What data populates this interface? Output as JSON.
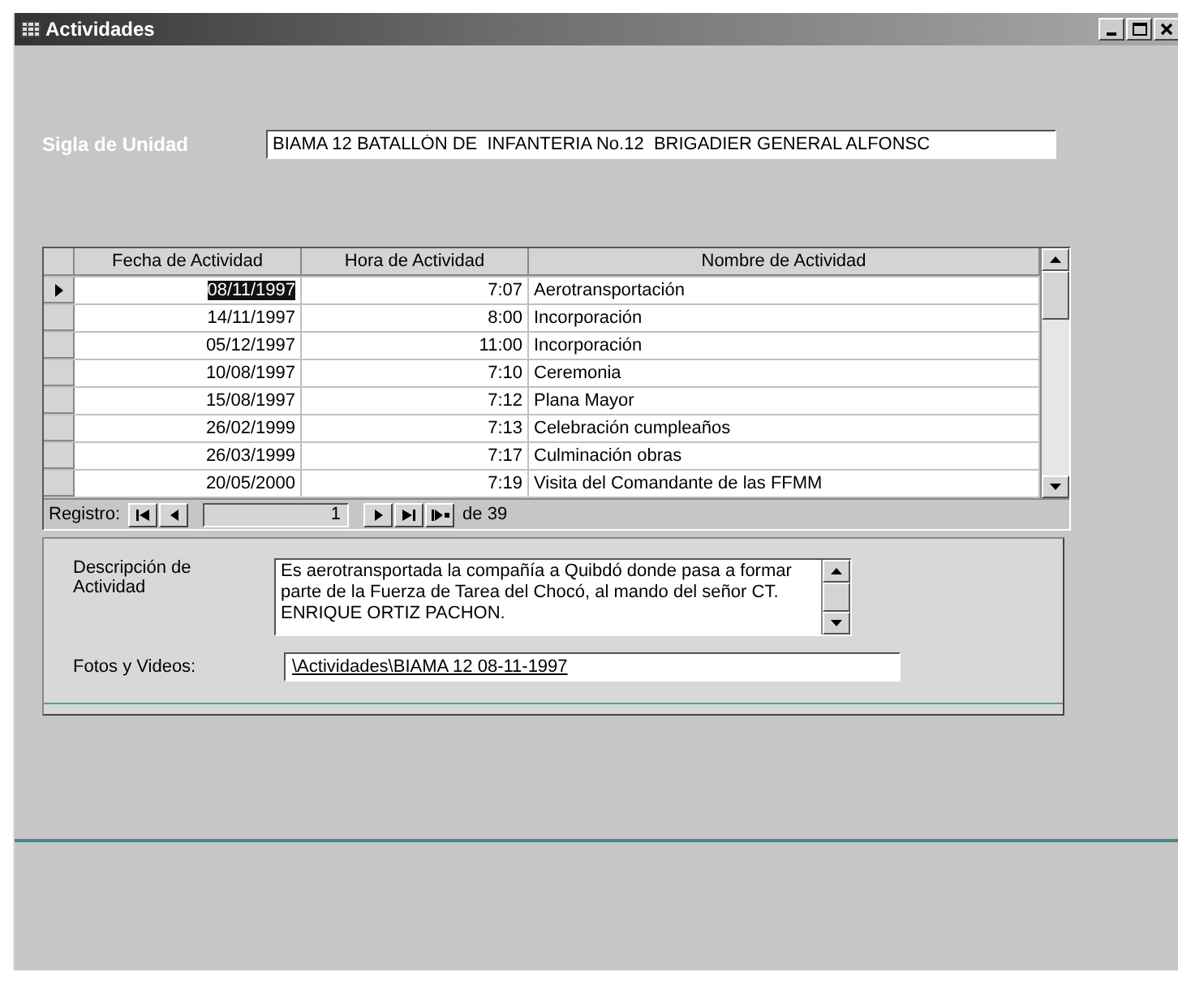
{
  "window": {
    "title": "Actividades"
  },
  "unit": {
    "label": "Sigla de Unidad",
    "value": "BIAMA 12 BATALLÓN DE  INFANTERIA No.12  BRIGADIER GENERAL ALFONSC"
  },
  "table": {
    "columns": [
      "Fecha de Actividad",
      "Hora de Actividad",
      "Nombre de Actividad"
    ],
    "rows": [
      {
        "date": "08/11/1997",
        "time": "7:07",
        "name": "Aerotransportación",
        "selected": true
      },
      {
        "date": "14/11/1997",
        "time": "8:00",
        "name": "Incorporación",
        "selected": false
      },
      {
        "date": "05/12/1997",
        "time": "11:00",
        "name": "Incorporación",
        "selected": false
      },
      {
        "date": "10/08/1997",
        "time": "7:10",
        "name": "Ceremonia",
        "selected": false
      },
      {
        "date": "15/08/1997",
        "time": "7:12",
        "name": "Plana Mayor",
        "selected": false
      },
      {
        "date": "26/02/1999",
        "time": "7:13",
        "name": "Celebración cumpleaños",
        "selected": false
      },
      {
        "date": "26/03/1999",
        "time": "7:17",
        "name": "Culminación obras",
        "selected": false
      },
      {
        "date": "20/05/2000",
        "time": "7:19",
        "name": "Visita del Comandante de las FFMM",
        "selected": false
      }
    ]
  },
  "navigator": {
    "label": "Registro:",
    "current": "1",
    "total": "de 39"
  },
  "description": {
    "label": "Descripción de Actividad",
    "value": "Es aerotransportada  la compañía a Quibdó donde pasa a formar  parte de la Fuerza de Tarea del Chocó, al mando del señor CT. ENRIQUE ORTIZ PACHON."
  },
  "media": {
    "label": "Fotos y Videos:",
    "link": "\\Actividades\\BIAMA 12 08-11-1997"
  }
}
